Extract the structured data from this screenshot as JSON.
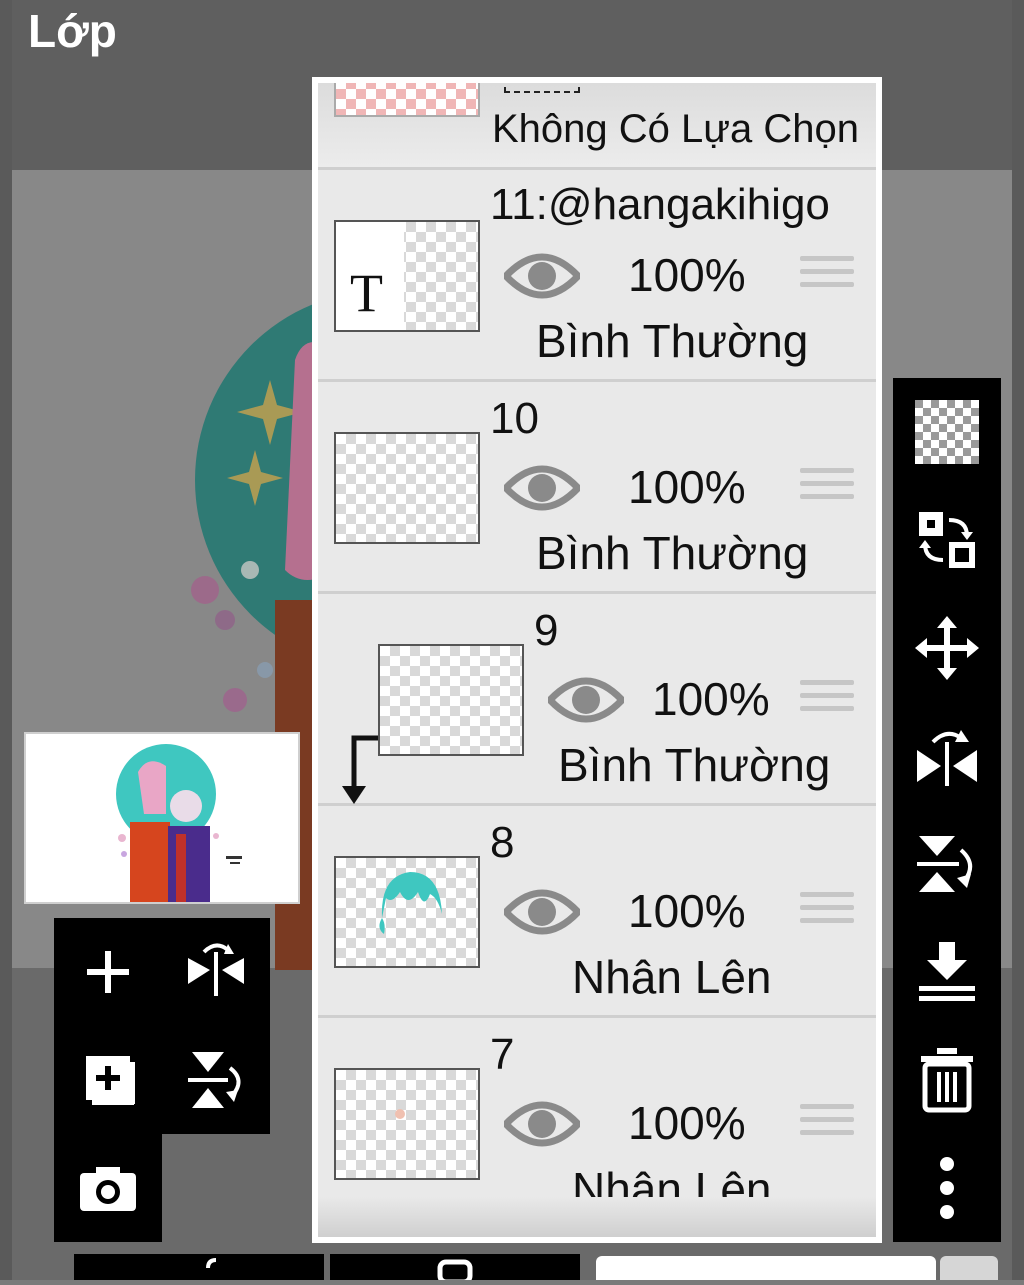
{
  "header": {
    "title": "Lớp"
  },
  "layers": [
    {
      "name": "",
      "blend": "Không Có Lựa Chọn",
      "partial": true
    },
    {
      "name": "11:@hangakihigo",
      "opacity": "100%",
      "blend": "Bình Thường",
      "thumb": "text",
      "thumb_glyph": "T"
    },
    {
      "name": "10",
      "opacity": "100%",
      "blend": "Bình Thường"
    },
    {
      "name": "9",
      "opacity": "100%",
      "blend": "Bình Thường",
      "clipped": true
    },
    {
      "name": "8",
      "opacity": "100%",
      "blend": "Nhân Lên",
      "thumb": "hair"
    },
    {
      "name": "7",
      "opacity": "100%",
      "blend": "Nhân Lên"
    }
  ],
  "colors": {
    "panel_bg": "#e9e9e9",
    "toolbar_bg": "#000000",
    "accent_teal": "#3fc7c0"
  },
  "left_tools": [
    "add-layer-icon",
    "flip-horizontal-icon",
    "add-copy-icon",
    "flip-vertical-icon",
    "camera-icon"
  ],
  "right_tools": [
    "transparency-icon",
    "swap-layer-icon",
    "move-icon",
    "flip-horizontal-rotate-icon",
    "flip-vertical-rotate-icon",
    "merge-down-icon",
    "trash-icon",
    "more-icon"
  ]
}
